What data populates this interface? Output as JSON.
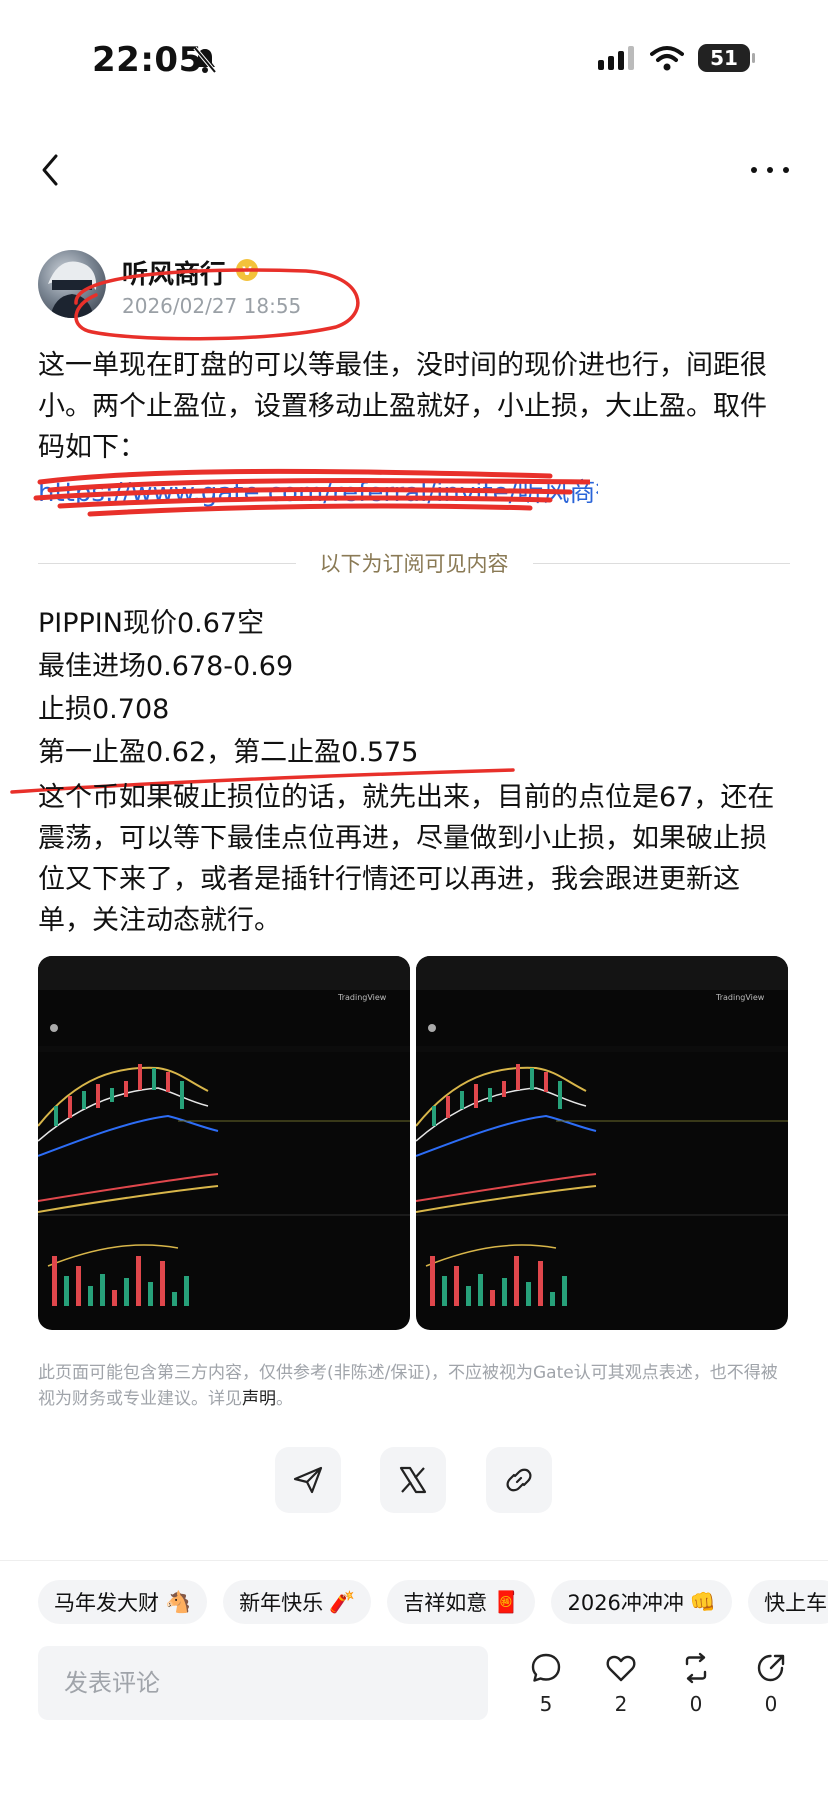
{
  "status_bar": {
    "time": "22:05",
    "battery": "51"
  },
  "author": {
    "name": "听风商行",
    "time": "2026/02/27 18:55"
  },
  "post": {
    "intro": "这一单现在盯盘的可以等最佳，没时间的现价进也行，间距很小。两个止盈位，设置移动止盈就好，小止损，大止盈。取件码如下：",
    "link": "https://www.gate.com/referral/invite/听风商行",
    "divider": "以下为订阅可见内容",
    "lines": [
      "PIPPIN现价0.67空",
      "最佳进场0.678-0.69",
      "止损0.708",
      "第一止盈0.62，第二止盈0.575"
    ],
    "paragraph": "这个币如果破止损位的话，就先出来，目前的点位是67，还在震荡，可以等下最佳点位再进，尽量做到小止损，如果破止损位又下来了，或者是插针行情还可以再进，我会跟进更新这单，关注动态就行。"
  },
  "chart_cards": [
    {
      "toolbar": [
        "蜡烛图",
        "TradingView"
      ]
    },
    {
      "toolbar": [
        "蜡烛图",
        "TradingView"
      ]
    }
  ],
  "disclaimer": {
    "text": "此页面可能包含第三方内容，仅供参考(非陈述/保证)，不应被视为Gate认可其观点表述，也不得被视为财务或专业建议。详见",
    "link": "声明",
    "end": "。"
  },
  "tags": [
    {
      "label": "马年发大财",
      "emoji": "🐴"
    },
    {
      "label": "新年快乐",
      "emoji": "🧨"
    },
    {
      "label": "吉祥如意",
      "emoji": "🧧"
    },
    {
      "label": "2026冲冲冲",
      "emoji": "👊"
    },
    {
      "label": "快上车",
      "emoji": ""
    }
  ],
  "comment": {
    "placeholder": "发表评论"
  },
  "actions": {
    "comments": "5",
    "likes": "2",
    "reposts": "0",
    "shares": "0"
  },
  "colors": {
    "link": "#2a64d8",
    "scribble": "#e8302a",
    "verified": "#f3c23b"
  }
}
